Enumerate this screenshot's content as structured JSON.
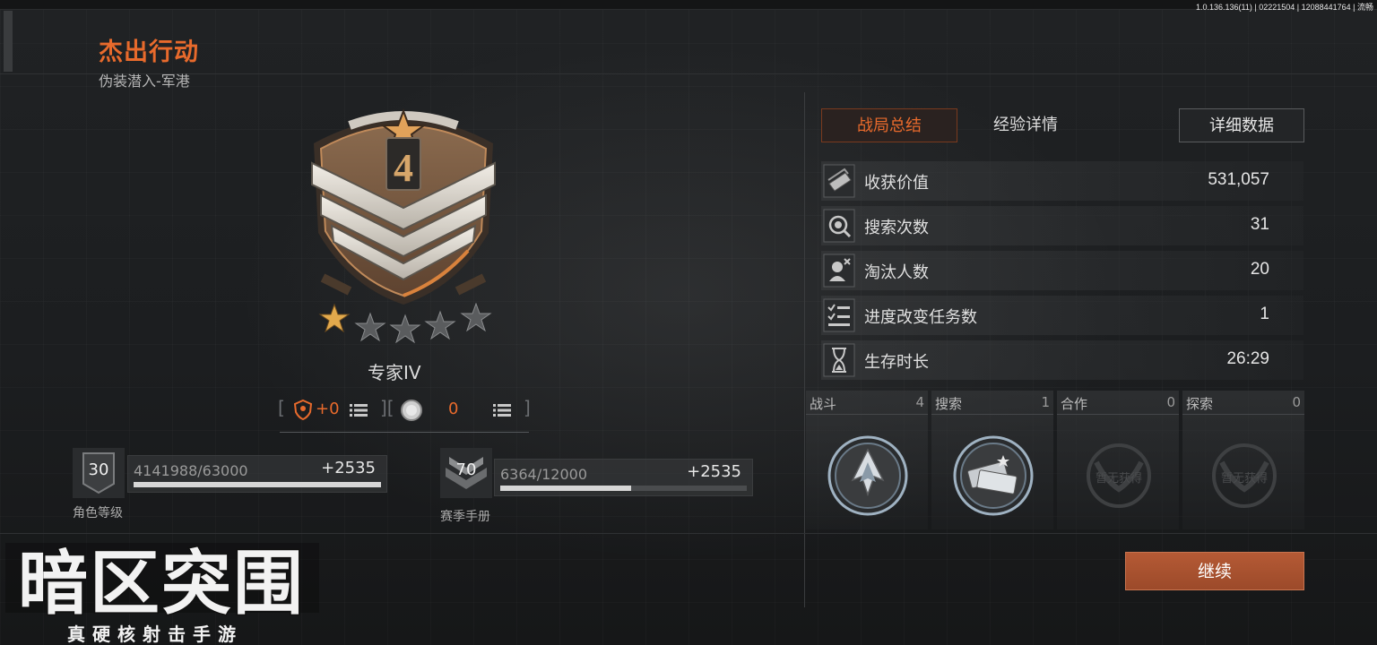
{
  "version": "1.0.136.136(11) | 02221504 | 12088441764 | 流畅",
  "title": "杰出行动",
  "subtitle": "伪装潜入-军港",
  "rank": {
    "badge_number": "4",
    "stars_filled": 1,
    "stars_total": 5,
    "name": "专家IV",
    "reward_left": "+0",
    "reward_right": "0",
    "bracket_open": "[",
    "bracket_mid": "][",
    "bracket_close": "]"
  },
  "progress": {
    "character": {
      "level": "30",
      "xp_text": "4141988/63000",
      "gain": "+2535",
      "caption": "角色等级",
      "fill": 1.0
    },
    "season": {
      "level": "70",
      "xp_text": "6364/12000",
      "gain": "+2535",
      "caption": "赛季手册",
      "fill": 0.53
    }
  },
  "tabs": {
    "summary": "战局总结",
    "experience": "经验详情",
    "detail": "详细数据"
  },
  "stats": [
    {
      "label": "收获价值",
      "value": "531,057",
      "icon": "money-icon"
    },
    {
      "label": "搜索次数",
      "value": "31",
      "icon": "search-icon"
    },
    {
      "label": "淘汰人数",
      "value": "20",
      "icon": "elimination-icon"
    },
    {
      "label": "进度改变任务数",
      "value": "1",
      "icon": "task-list-icon"
    },
    {
      "label": "生存时长",
      "value": "26:29",
      "icon": "hourglass-icon"
    }
  ],
  "categories": [
    {
      "name": "战斗",
      "count": "4",
      "obtained": true
    },
    {
      "name": "搜索",
      "count": "1",
      "obtained": true
    },
    {
      "name": "合作",
      "count": "0",
      "obtained": false,
      "placeholder": "暂无获得"
    },
    {
      "name": "探索",
      "count": "0",
      "obtained": false,
      "placeholder": "暂无获得"
    }
  ],
  "continue_label": "继续",
  "logo": {
    "title": "暗区突围",
    "subtitle": "真硬核射击手游"
  },
  "colors": {
    "accent": "#e86a2c",
    "button": "#a85232"
  }
}
